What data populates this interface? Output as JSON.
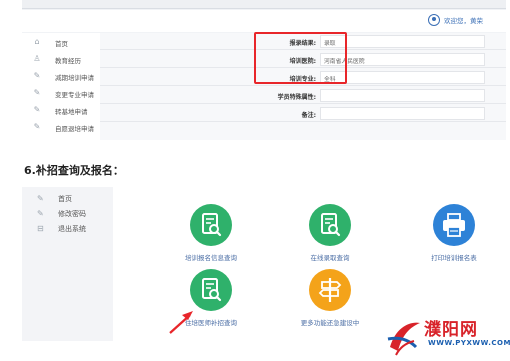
{
  "top_screenshot": {
    "welcome": "欢迎您，黄荣",
    "sidebar": [
      {
        "label": "首页",
        "icon": "home-icon"
      },
      {
        "label": "教育经历",
        "icon": "user-icon"
      },
      {
        "label": "减期培训申请",
        "icon": "pencil-icon"
      },
      {
        "label": "变更专业申请",
        "icon": "pencil-icon"
      },
      {
        "label": "转基地申请",
        "icon": "pencil-icon"
      },
      {
        "label": "自愿退培申请",
        "icon": "pencil-icon"
      }
    ],
    "form": [
      {
        "key": "报录结果:",
        "value": "录取"
      },
      {
        "key": "培训医院:",
        "value": "河南省人民医院"
      },
      {
        "key": "培训专业:",
        "value": "全科"
      },
      {
        "key": "学员特殊属性:",
        "value": ""
      },
      {
        "key": "备注:",
        "value": ""
      }
    ],
    "highlight_color": "#e8262a"
  },
  "heading": "6.补招查询及报名：",
  "bottom_screenshot": {
    "sidebar": [
      {
        "label": "首页",
        "icon": "pencil-icon"
      },
      {
        "label": "修改密码",
        "icon": "pencil-icon"
      },
      {
        "label": "退出系统",
        "icon": "logout-icon"
      }
    ],
    "tiles": [
      {
        "label": "培训报名信息查询",
        "color": "#2fb16b",
        "icon": "document-search-icon"
      },
      {
        "label": "在线录取查询",
        "color": "#2fb16b",
        "icon": "document-search-icon"
      },
      {
        "label": "打印培训报名表",
        "color": "#2d82d7",
        "icon": "printer-icon"
      },
      {
        "label": "住培医师补招查询",
        "color": "#2fb16b",
        "icon": "document-search-icon"
      },
      {
        "label": "更多功能还急建设中",
        "color": "#f4a31a",
        "icon": "signpost-icon"
      }
    ],
    "arrow_color": "#e8262a"
  },
  "watermark": {
    "name": "濮阳网",
    "url": "WWW.PYXWW.COM"
  }
}
